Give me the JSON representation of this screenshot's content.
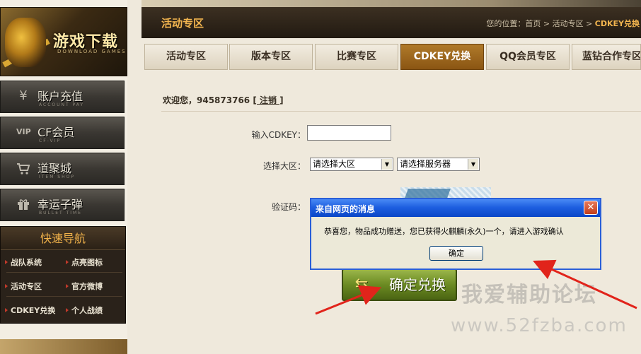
{
  "sidebar": {
    "banner": {
      "title": "游戏下载",
      "subtitle": "DOWNLOAD GAMES"
    },
    "menu": [
      {
        "label": "账户充值",
        "en": "ACCOUNT PAY",
        "icon": "yen-icon"
      },
      {
        "label": "CF会员",
        "en": "CF-VIP",
        "icon": "vip-icon"
      },
      {
        "label": "道聚城",
        "en": "ITEM SHOP",
        "icon": "cart-icon"
      },
      {
        "label": "幸运子弹",
        "en": "BULLET TIME",
        "icon": "gift-icon"
      }
    ],
    "quicknav": {
      "title": "快速导航",
      "items": [
        "战队系统",
        "点亮图标",
        "活动专区",
        "官方微博",
        "CDKEY兑换",
        "个人战绩"
      ]
    }
  },
  "header": {
    "title": "活动专区",
    "breadcrumb_prefix": "您的位置：首页 > 活动专区 > ",
    "breadcrumb_current": "CDKEY兑换"
  },
  "tabs": [
    "活动专区",
    "版本专区",
    "比赛专区",
    "CDKEY兑换",
    "QQ会员专区",
    "蓝钻合作专区"
  ],
  "active_tab": "CDKEY兑换",
  "welcome": {
    "text": "欢迎您，945873766",
    "logout": "[ 注销 ]"
  },
  "form": {
    "cdkey_label": "输入CDKEY：",
    "cdkey_value": "",
    "region_label": "选择大区：",
    "region_select": "请选择大区",
    "server_select": "请选择服务器",
    "captcha_label": "验证码：",
    "submit": "确定兑换"
  },
  "dialog": {
    "title": "来自网页的消息",
    "close": "✕",
    "message": "恭喜您，物品成功赠送，您已获得火麒麟(永久)一个，请进入游戏确认",
    "ok": "确定"
  },
  "watermark": {
    "line1": "我爱辅助论坛",
    "line2": "www.52fzba.com"
  },
  "colors": {
    "accent": "#f2b54f",
    "active_tab": "#9a6418",
    "dialog_title": "#1e5fe0"
  }
}
